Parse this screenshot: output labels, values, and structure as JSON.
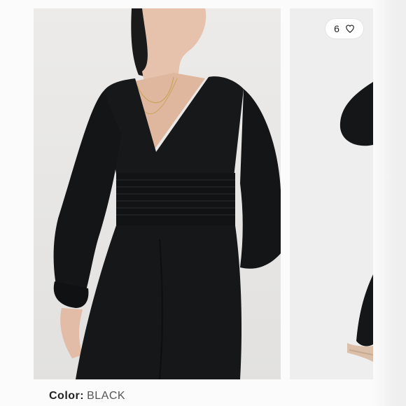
{
  "gallery": {
    "like_count": "6",
    "like_icon": "heart-icon"
  },
  "details": {
    "color_label": "Color:",
    "color_value": "BLACK"
  },
  "colors": {
    "garment": "#141517",
    "background": "#e9e8e6"
  }
}
